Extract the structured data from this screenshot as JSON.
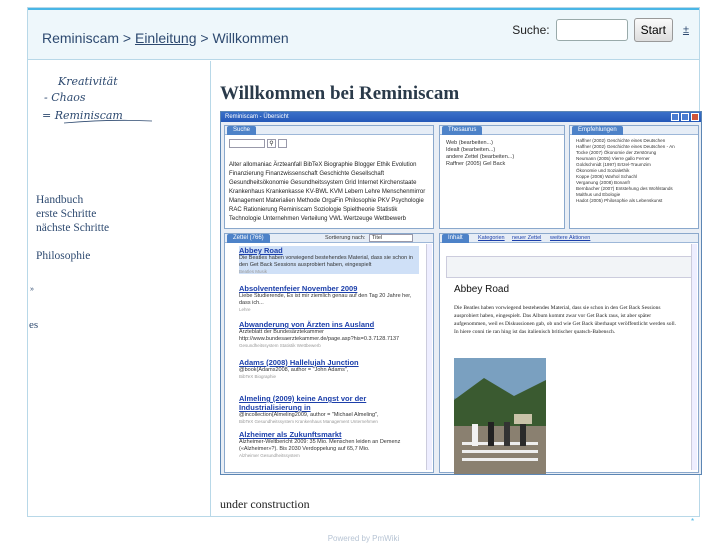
{
  "header": {
    "crumb_root": "Reminiscam",
    "crumb_sep": " > ",
    "crumb_link": "Einleitung",
    "crumb_current": "Willkommen",
    "search_label": "Suche:",
    "search_value": "",
    "search_button": "Start",
    "search_more": "±"
  },
  "sidebar": {
    "logo_line1": "Kreativität",
    "logo_line2": "- Chaos",
    "logo_line3": "= Reminiscam",
    "items": [
      "Handbuch",
      "erste Schritte",
      "nächste Schritte"
    ],
    "item_philosophie": "Philosophie",
    "stray_mark": "»",
    "stray_text": "es"
  },
  "main": {
    "title": "Willkommen bei Reminiscam",
    "footer_text": "under construction"
  },
  "screenshot": {
    "window_title": "Reminiscam - Übersicht",
    "tab_search": "Suche",
    "tab_thesaurus": "Thesaurus",
    "tab_literature": "Empfehlungen",
    "tab_zettel": "Zettel (766)",
    "sort_label": "Sortierung nach:",
    "sort_value": "Titel",
    "tab_inhalt": "Inhalt",
    "tabs_right": [
      "Kategorien",
      "neuer Zettel",
      "weitere Aktionen"
    ],
    "article_title": "Abbey Road",
    "article_body": "Die Beatles haben vorwiegend bestehendes Material, dass sie schon in den Get Back Sessions ausprobiert haben, eingespielt. Das Album kommt zwar vor Get Back raus, ist aber später aufgenommen, weil es Diskussionen gab, ob und wie Get Back überhaupt veröffentlicht werden soll. In hiere conni tie ran hing ist das italienisch britischer quatsch-Babensch.",
    "tags_line": "Alter allomaniac Ärzteanfall BibTeX Biographie Blogger Ethik Evolution Finanzierung Finanzwissenschaft Geschichte Gesellschaft Gesundheitsökonomie Gesundheitssystem Grid Internet Kirchenstaate Krankenhaus Krankenkasse KV-BWL KVM Lebern Lehre Menschenmirror Management Materialien Methode OrgaFin Philosophie PKV Psychologie RAC Rationierung Reminiscam Soziologie Spieltheorie Statistik Technologie Unternehmen Verteilung VWL Wertzeuge Wettbewerb",
    "thesaurus_lines": [
      "Web (bearbeiten...)",
      "Idealt (bearbeiten...)",
      "andere Zettel (bearbeiten...)",
      "Raffner (2005) Gel Back"
    ],
    "recommend_lines": [
      "Haffner (2002) Geschichte eines Deutschen",
      "Haffner (2002) Geschichte eines Deutschen - An",
      "Tocke (2007) Ökonomie der Zerstörung",
      "Neumann (2005) Vierre gallo Ferner",
      "Goldschmidt (1997) Ertzel-Traumzim",
      "Ökonomie und Sozialethik",
      "Koppe (2006) Warhol Schachl",
      "Verganung (2008) Bonanfr",
      "Bernbacher (2007) Entstehung des Wohlstands",
      "Malthus und Ebologie",
      "Hadot (2005) Philosophie als Lebenskunst"
    ],
    "rows": [
      {
        "title": "Abbey Road",
        "text": "Die Beatles haben vorwiegend bestehendes Material, dass sie schon in den Get Back Sessions ausprobiert haben, eingespielt",
        "sub": "Beatles Musik"
      },
      {
        "title": "Absolventenfeier November 2009",
        "text": "Liebe Studierende, Es ist mir ziemlich genau auf den Tag 20 Jahre her, dass ich...",
        "sub": "Lehre"
      },
      {
        "title": "Abwanderung von Ärzten ins Ausland",
        "text": "Ärzteblatt der Bundesärztekammer http://www.bundesaerztekammer.de/page.asp?his=0.3.7128.7137",
        "sub": "Gesundheitssystem Statistik Wettbewerb"
      },
      {
        "title": "Adams (2008) Hallelujah Junction",
        "text": "@book{Adams2008, author = \"John Adams\",",
        "sub": "BibTeX Biographie"
      },
      {
        "title": "Almeling (2009) keine Angst vor der Industrialisierung in",
        "text": "@incollection{Almeling2009, author = \"Michael Almeling\",",
        "sub": "BibTeX Gesundheitssystem Krankenhaus Management Unternehmen"
      },
      {
        "title": "Alzheimer als Zukunftsmarkt",
        "text": "Alzheimer-Weltbericht 2009: 35 Mio. Menschen leiden an Demenz («Alzheimer»?). Bis 2030 Verdoppelung auf 65,7 Mio.",
        "sub": "Alzheimer Gesundheitssystem"
      }
    ]
  },
  "footer": {
    "powered": "Powered by PmWiki",
    "corner_mark": "*"
  },
  "colors": {
    "accent": "#49b6e6",
    "link": "#2e4a70",
    "header_bg": "#eef7fb"
  }
}
